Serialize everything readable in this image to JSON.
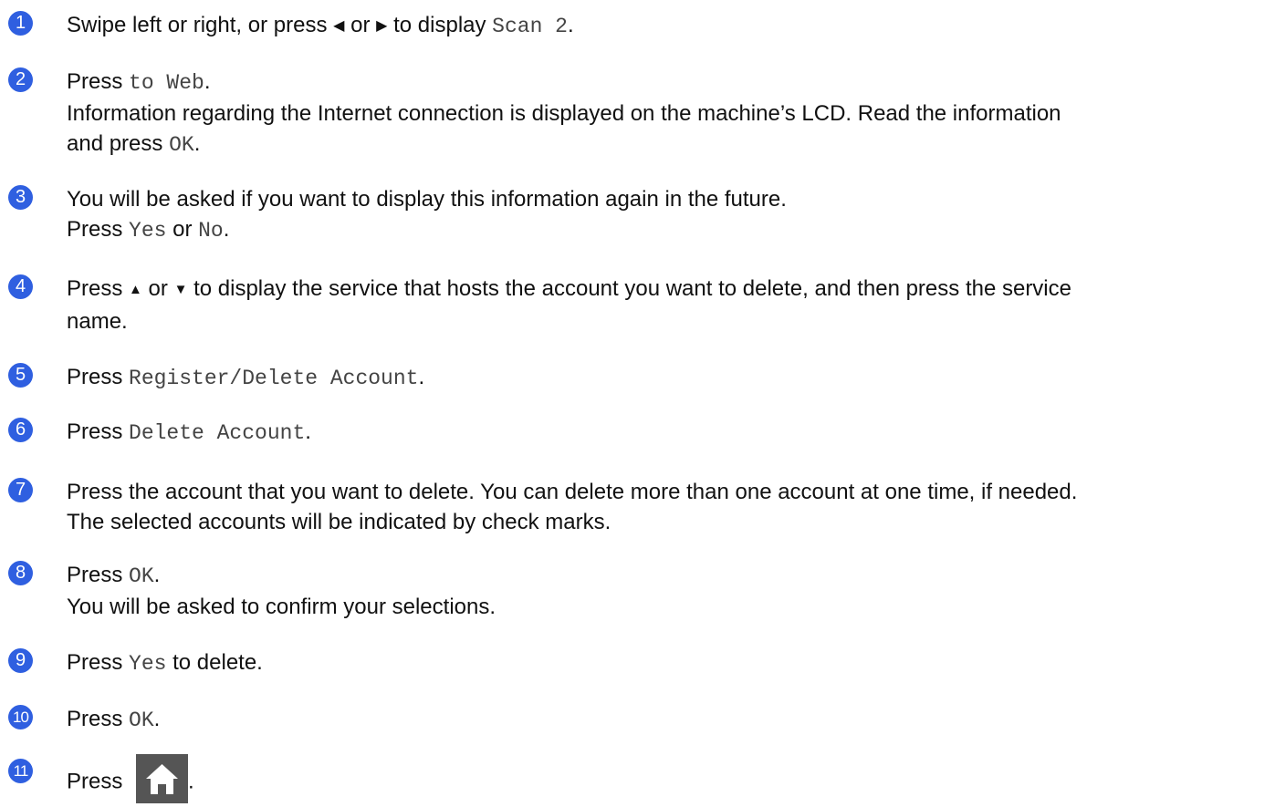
{
  "steps": [
    {
      "num": "1",
      "line1_a": "Swipe left or right, or press ",
      "left_arrow": "◀",
      "line1_b": " or ",
      "right_arrow": "▶",
      "line1_c": " to display ",
      "mono1": "Scan 2",
      "line1_d": "."
    },
    {
      "num": "2",
      "line1_a": "Press ",
      "mono1": "to Web",
      "line1_b": ".",
      "line2": "Information regarding the Internet connection is displayed on the machine’s LCD. Read the information",
      "line3_a": "and press ",
      "mono2": "OK",
      "line3_b": "."
    },
    {
      "num": "3",
      "line1": "You will be asked if you want to display this information again in the future.",
      "line2_a": "Press ",
      "mono1": "Yes",
      "line2_b": " or ",
      "mono2": "No",
      "line2_c": "."
    },
    {
      "num": "4",
      "line1_a": "Press ",
      "up_arrow": "▲",
      "line1_b": " or ",
      "down_arrow": "▼",
      "line1_c": " to display the service that hosts the account you want to delete, and then press the service",
      "line2": "name."
    },
    {
      "num": "5",
      "line1_a": "Press ",
      "mono1": "Register/Delete Account",
      "line1_b": "."
    },
    {
      "num": "6",
      "line1_a": "Press ",
      "mono1": "Delete Account",
      "line1_b": "."
    },
    {
      "num": "7",
      "line1": "Press the account that you want to delete. You can delete more than one account at one time, if needed.",
      "line2": "The selected accounts will be indicated by check marks."
    },
    {
      "num": "8",
      "line1_a": "Press ",
      "mono1": "OK",
      "line1_b": ".",
      "line2": "You will be asked to confirm your selections."
    },
    {
      "num": "9",
      "line1_a": "Press ",
      "mono1": "Yes",
      "line1_b": " to delete."
    },
    {
      "num": "10",
      "line1_a": "Press ",
      "mono1": "OK",
      "line1_b": "."
    },
    {
      "num": "11",
      "line1_a": "Press ",
      "icon": "home-icon",
      "line1_b": "."
    }
  ],
  "colors": {
    "step_badge": "#2f5fe0",
    "home_icon_bg": "#555555"
  }
}
